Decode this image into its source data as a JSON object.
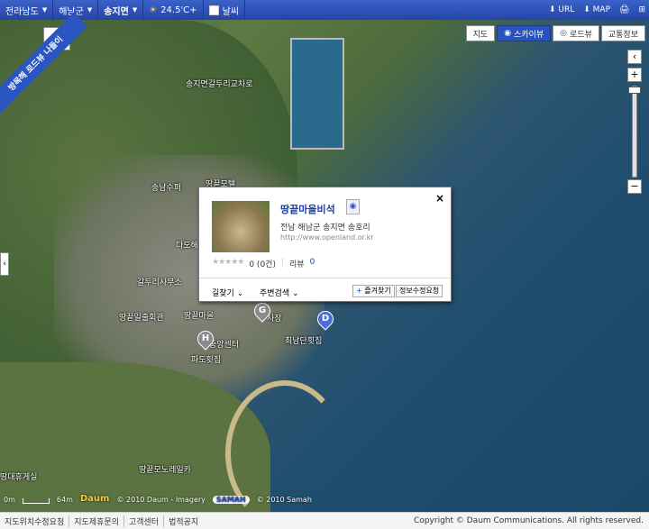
{
  "topbar": {
    "locations": [
      "전라남도",
      "해남군",
      "송지면"
    ],
    "weather_temp": "24.5'C+",
    "weather_label": "날씨",
    "url_label": "URL",
    "map_label": "MAP"
  },
  "view_buttons": [
    "지도",
    "스카이뷰",
    "로드뷰",
    "교통정보"
  ],
  "banner": "방목해 로드뷰 나들이",
  "popup": {
    "title": "땅끝마을비석",
    "address": "전남 해남군 송지면 송호리",
    "url": "http://www.openland.or.kr",
    "rating_text": "0 (0건)",
    "review_label": "리뷰",
    "review_count": "0",
    "directions": "길찾기",
    "nearby": "주변검색",
    "favorite": "즐겨찾기",
    "edit_info": "정보수정요청",
    "close": "×"
  },
  "map_labels": [
    "송지면갈두리교차로",
    "땅끝모텔",
    "송남수퍼",
    "다도해",
    "갈두리사무소",
    "땅끝일출회관",
    "땅끝마을",
    "사장",
    "최남단횟집",
    "중앙센터",
    "파도횟집",
    "땅끝모노레일카",
    "땅대휴게실"
  ],
  "markers": [
    "D",
    "G",
    "H"
  ],
  "scale": {
    "left": "0m",
    "right": "64m"
  },
  "imagery_credit": "© 2010 Daum - Imagery",
  "samah_credit": "© 2010 Samah",
  "footer": {
    "links": [
      "지도위치수정요청",
      "지도제휴문의",
      "고객센터",
      "법적공지"
    ],
    "copyright": "Copyright © Daum Communications. All rights reserved."
  }
}
